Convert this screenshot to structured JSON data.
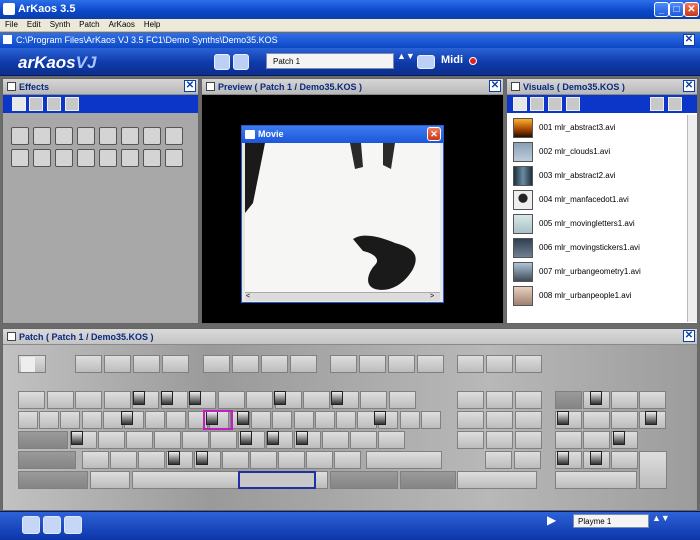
{
  "window": {
    "title": "ArKaos 3.5",
    "min": "_",
    "max": "□",
    "close": "✕"
  },
  "menu": [
    "File",
    "Edit",
    "Synth",
    "Patch",
    "ArKaos",
    "Help"
  ],
  "path": {
    "text": "C:\\Program Files\\ArKaos VJ 3.5 FC1\\Demo Synths\\Demo35.KOS",
    "close": "✕"
  },
  "toolbar": {
    "logo": "arKaos",
    "logo_suffix": "VJ",
    "patch_value": "Patch 1",
    "spin": "▲▼",
    "midi_label": "Midi"
  },
  "effects": {
    "title": "Effects",
    "close": "✕"
  },
  "preview": {
    "title": "Preview ( Patch 1 / Demo35.KOS )",
    "close": "✕"
  },
  "movie": {
    "title": "Movie",
    "close": "✕",
    "scroll_left": "<",
    "scroll_right": ">"
  },
  "visuals": {
    "title": "Visuals ( Demo35.KOS )",
    "close": "✕",
    "items": [
      {
        "label": "001 mlr_abstract3.avi"
      },
      {
        "label": "002 mlr_clouds1.avi"
      },
      {
        "label": "003 mlr_abstract2.avi"
      },
      {
        "label": "004 mlr_manfacedot1.avi"
      },
      {
        "label": "005 mlr_movingletters1.avi"
      },
      {
        "label": "006 mlr_movingstickers1.avi"
      },
      {
        "label": "007 mlr_urbangeometry1.avi"
      },
      {
        "label": "008 mlr_urbanpeople1.avi"
      }
    ]
  },
  "patch": {
    "title": "Patch ( Patch 1 / Demo35.KOS )",
    "close": "✕"
  },
  "bottombar": {
    "play": "▶",
    "playme_value": "Playme 1",
    "spin": "▲▼"
  }
}
